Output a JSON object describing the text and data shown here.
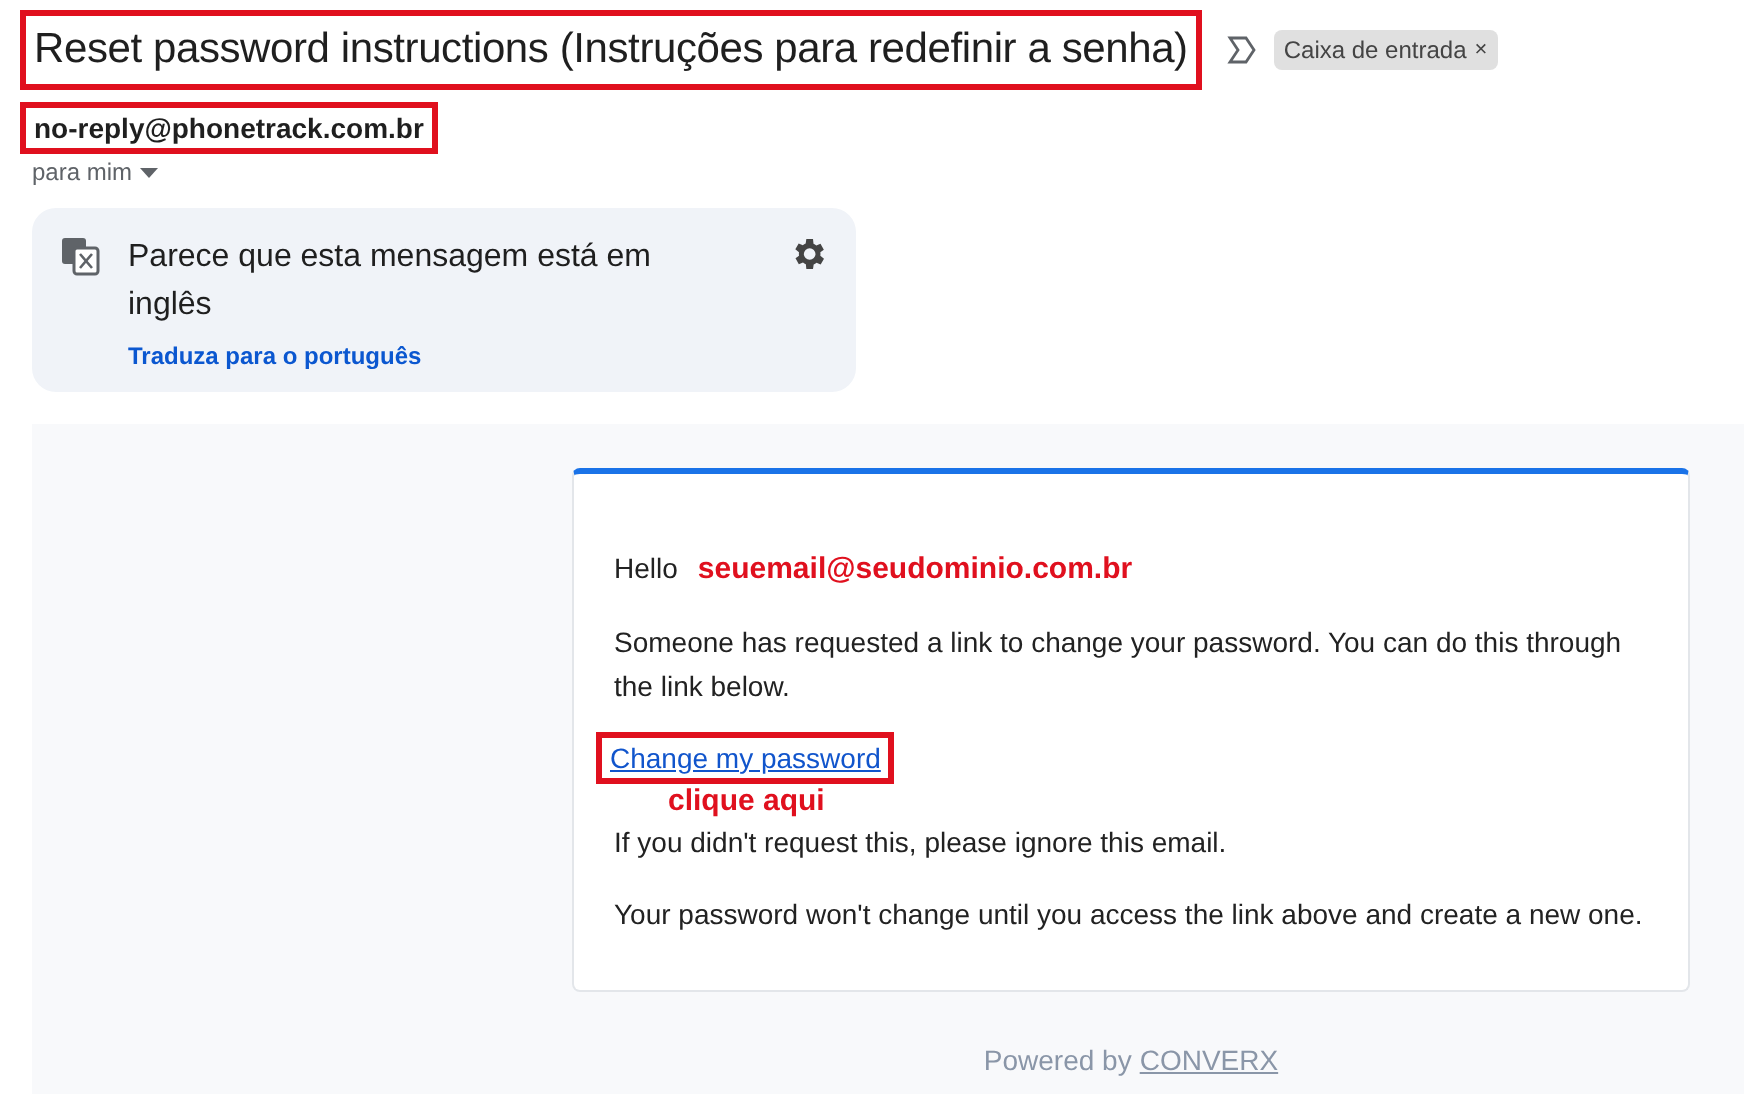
{
  "subject": {
    "text": "Reset password instructions (Instruções para redefinir a senha)",
    "highlighted": true
  },
  "label_chip": {
    "text": "Caixa de entrada",
    "close": "×"
  },
  "sender": {
    "email": "no-reply@phonetrack.com.br",
    "highlighted": true,
    "recipient": "para mim"
  },
  "translate_banner": {
    "message": "Parece que esta mensagem está em inglês",
    "action": "Traduza para o português"
  },
  "email_body": {
    "greeting": "Hello",
    "annotation_email": "seuemail@seudominio.com.br",
    "paragraph_1": "Someone has requested a link to change your password. You can do this through the link below.",
    "link": {
      "text": "Change my password",
      "highlighted": true
    },
    "annotation_link": "clique aqui",
    "paragraph_2": "If you didn't request this, please ignore this email.",
    "paragraph_3": "Your password won't change until you access the link above and create a new one."
  },
  "footer": {
    "text": "Powered by",
    "link": "CONVERX"
  }
}
